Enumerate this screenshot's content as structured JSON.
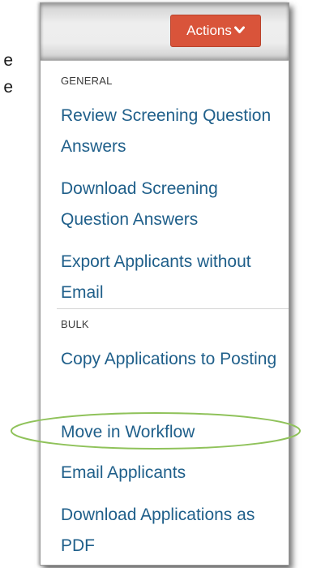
{
  "background_fragments": [
    "e",
    "e"
  ],
  "toolbar": {
    "actions_label": "Actions",
    "actions_icon": "chevron-down-icon",
    "actions_color": "#d9543a"
  },
  "menu": {
    "sections": [
      {
        "header": "GENERAL",
        "items": [
          "Review Screening Question Answers",
          "Download Screening Question Answers",
          "Export Applicants without Email"
        ]
      },
      {
        "header": "BULK",
        "items": [
          "Copy Applications to Posting",
          "Move in Workflow",
          "Email Applicants",
          "Download Applications as PDF"
        ]
      }
    ],
    "link_color": "#1f5f8a",
    "highlighted_item": "Move in Workflow",
    "highlight_color": "#8fc25a"
  }
}
